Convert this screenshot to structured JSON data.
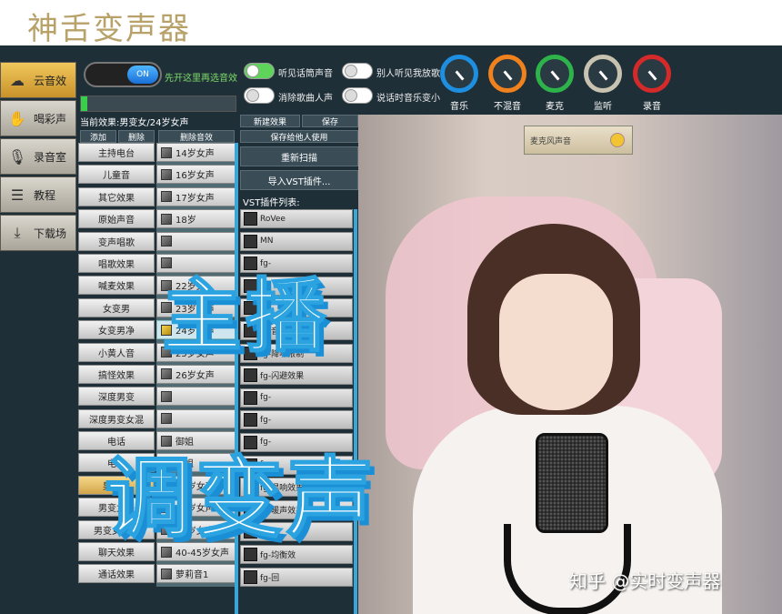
{
  "app_title": "神舌变声器",
  "sidebar": {
    "items": [
      {
        "label": "云音效",
        "icon": "cloud-icon",
        "active": true
      },
      {
        "label": "喝彩声",
        "icon": "clap-icon",
        "active": false
      },
      {
        "label": "录音室",
        "icon": "microphone-icon",
        "active": false
      },
      {
        "label": "教程",
        "icon": "tutorial-icon",
        "active": false
      },
      {
        "label": "下载场",
        "icon": "download-icon",
        "active": false
      }
    ]
  },
  "power": {
    "state_label": "ON",
    "hint": "先开这里再选音效",
    "level_fraction": 0.04
  },
  "switches": [
    {
      "label": "听见话筒声音",
      "on": true
    },
    {
      "label": "消除歌曲人声",
      "on": false
    },
    {
      "label": "别人听见我放歌",
      "on": false
    },
    {
      "label": "说话时音乐变小",
      "on": false
    }
  ],
  "knobs": [
    {
      "label": "音乐",
      "color": "#1e8fe0"
    },
    {
      "label": "不混音",
      "color": "#f0821e"
    },
    {
      "label": "麦克",
      "color": "#2db34a"
    },
    {
      "label": "监听",
      "color": "#c8c2b0"
    },
    {
      "label": "录音",
      "color": "#d52a2a"
    }
  ],
  "effects_panel": {
    "current_effect": "当前效果:男变女/24岁女声",
    "add_label": "添加",
    "delete_label": "删除",
    "delete_effect_label": "删除音效",
    "new_effect_label": "新建效果",
    "save_label": "保存",
    "save_share_label": "保存给他人使用",
    "rescan_label": "重新扫描",
    "import_vst_label": "导入VST插件...",
    "vst_list_label": "VST插件列表:"
  },
  "categories": [
    {
      "label": "主持电台",
      "selected": false
    },
    {
      "label": "儿童音",
      "selected": false
    },
    {
      "label": "其它效果",
      "selected": false
    },
    {
      "label": "原始声音",
      "selected": false
    },
    {
      "label": "变声唱歌",
      "selected": false
    },
    {
      "label": "唱歌效果",
      "selected": false
    },
    {
      "label": "喊麦效果",
      "selected": false
    },
    {
      "label": "女变男",
      "selected": false
    },
    {
      "label": "女变男净",
      "selected": false
    },
    {
      "label": "小黄人音",
      "selected": false
    },
    {
      "label": "搞怪效果",
      "selected": false
    },
    {
      "label": "深度男变",
      "selected": false
    },
    {
      "label": "深度男变女混",
      "selected": false
    },
    {
      "label": "电话",
      "selected": false
    },
    {
      "label": "电音",
      "selected": false
    },
    {
      "label": "男变女",
      "selected": true
    },
    {
      "label": "男变女净",
      "selected": false
    },
    {
      "label": "男变女即时",
      "selected": false
    },
    {
      "label": "聊天效果",
      "selected": false
    },
    {
      "label": "通话效果",
      "selected": false
    }
  ],
  "voices": [
    {
      "label": "14岁女声",
      "selected": false
    },
    {
      "label": "16岁女声",
      "selected": false
    },
    {
      "label": "17岁女声",
      "selected": false
    },
    {
      "label": "18岁",
      "selected": false
    },
    {
      "label": "",
      "selected": false
    },
    {
      "label": "",
      "selected": false
    },
    {
      "label": "22岁女",
      "selected": false
    },
    {
      "label": "23岁女声",
      "selected": false
    },
    {
      "label": "24岁女声",
      "selected": true
    },
    {
      "label": "25岁女声",
      "selected": false
    },
    {
      "label": "26岁女声",
      "selected": false
    },
    {
      "label": "",
      "selected": false
    },
    {
      "label": "",
      "selected": false
    },
    {
      "label": "御姐",
      "selected": false
    },
    {
      "label": "御姐",
      "selected": false
    },
    {
      "label": "33岁女声",
      "selected": false
    },
    {
      "label": "35岁女声",
      "selected": false
    },
    {
      "label": "36岁女声",
      "selected": false
    },
    {
      "label": "40-45岁女声",
      "selected": false
    },
    {
      "label": "萝莉音1",
      "selected": false
    }
  ],
  "vst_plugins": [
    "RoVee",
    "MN",
    "fg-",
    "fg-",
    "fg-",
    "fg-音量条",
    "fg-降噪限制",
    "fg-闪避效果",
    "fg-",
    "fg-",
    "fg-",
    "fg-",
    "fg-混响效果",
    "fg-暖声效果",
    "fg-多",
    "fg-均衡效",
    "fg-回"
  ],
  "mic_widget_label": "麦克风声音",
  "overlay": {
    "line1": "主播",
    "line2": "调变声"
  },
  "watermark": "知乎 @实时变声器"
}
